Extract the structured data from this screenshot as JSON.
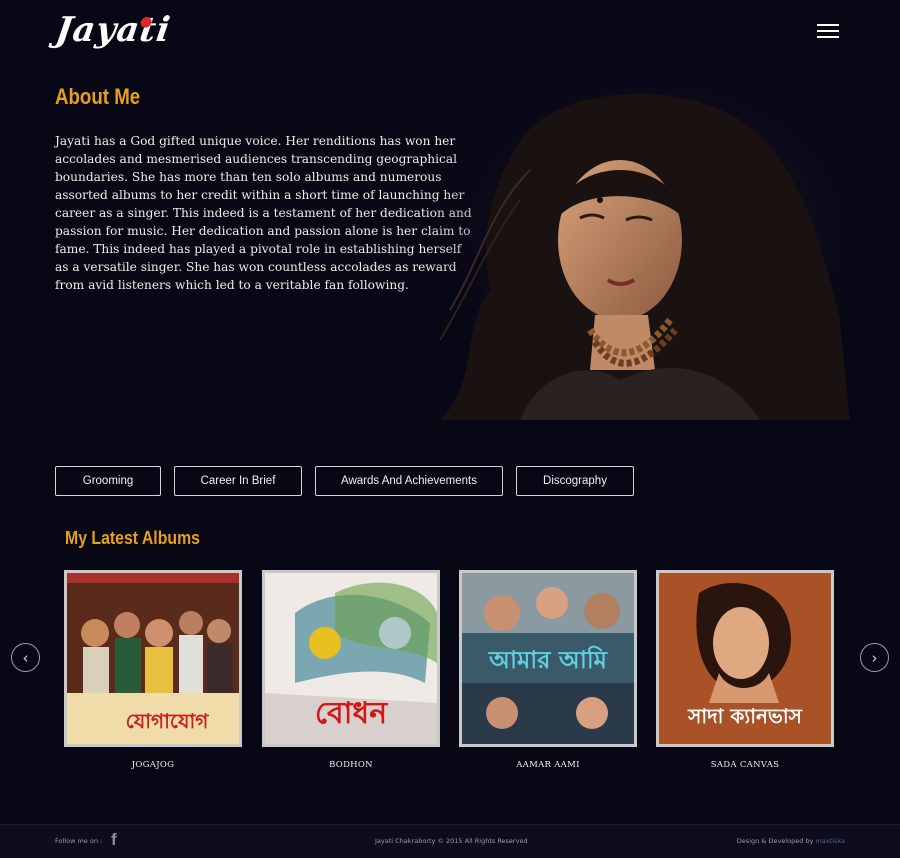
{
  "header": {
    "logo_text": "Jayati",
    "menu_icon": "hamburger-icon"
  },
  "about": {
    "title": "About Me",
    "text": "Jayati has a God gifted unique voice. Her renditions has won her accolades and mesmerised audiences transcending geographical boundaries. She has more than ten solo albums and numerous assorted albums to her credit within a short time of launching her career as a singer. This indeed is a testament of her dedication and passion for music. Her dedication and passion alone is her claim to fame. This indeed has played a pivotal role in establishing herself as a versatile singer. She has won countless accolades as reward from avid listeners which led to a veritable fan following."
  },
  "tabs": [
    "Grooming",
    "Career In Brief",
    "Awards And Achievements",
    "Discography"
  ],
  "albums": {
    "title": "My Latest Albums",
    "items": [
      {
        "name": "JOGAJOG",
        "cover_text": "যোগাযোগ"
      },
      {
        "name": "BODHON",
        "cover_text": "বোধন"
      },
      {
        "name": "AAMAR AAMI",
        "cover_text": "আমার আমি"
      },
      {
        "name": "SADA CANVAS",
        "cover_text": "সাদা ক্যানভাস"
      }
    ],
    "prev_icon": "chevron-left-icon",
    "next_icon": "chevron-right-icon"
  },
  "footer": {
    "follow_label": "Follow me on :",
    "facebook_icon": "f",
    "copyright": "Jayati Chakraborty © 2015 All Rights Reserved",
    "developed_prefix": "Design & Developed by",
    "developer": "maxtiska"
  },
  "colors": {
    "accent": "#e6a01c",
    "background": "#080716"
  }
}
